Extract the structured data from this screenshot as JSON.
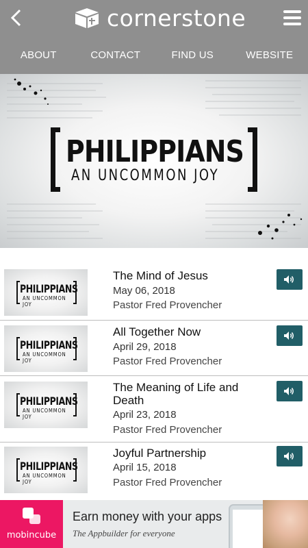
{
  "header": {
    "brand_name": "cornerstone",
    "back_icon": "chevron-left-icon",
    "menu_icon": "hamburger-menu-icon"
  },
  "nav": {
    "items": [
      {
        "label": "ABOUT"
      },
      {
        "label": "CONTACT"
      },
      {
        "label": "FIND US"
      },
      {
        "label": "WEBSITE"
      }
    ]
  },
  "hero": {
    "title": "PHILIPPIANS",
    "subtitle": "AN UNCOMMON JOY"
  },
  "sermons": [
    {
      "title": "The Mind of Jesus",
      "date": "May 06, 2018",
      "pastor": "Pastor Fred Provencher",
      "thumb_title": "PHILIPPIANS",
      "thumb_subtitle": "AN UNCOMMON JOY"
    },
    {
      "title": "All Together Now",
      "date": "April 29, 2018",
      "pastor": "Pastor Fred Provencher",
      "thumb_title": "PHILIPPIANS",
      "thumb_subtitle": "AN UNCOMMON JOY"
    },
    {
      "title": "The Meaning of Life and Death",
      "date": "April 23, 2018",
      "pastor": "Pastor Fred Provencher",
      "thumb_title": "PHILIPPIANS",
      "thumb_subtitle": "AN UNCOMMON JOY"
    },
    {
      "title": "Joyful Partnership",
      "date": "April 15, 2018",
      "pastor": "Pastor Fred Provencher",
      "thumb_title": "PHILIPPIANS",
      "thumb_subtitle": "AN UNCOMMON JOY"
    }
  ],
  "ad": {
    "brand": "mobincube",
    "headline": "Earn money with your apps",
    "tagline": "The Appbuilder for everyone"
  },
  "colors": {
    "header_bg": "#8f8f8f",
    "audio_button": "#215e67",
    "ad_brand": "#ec1763"
  }
}
